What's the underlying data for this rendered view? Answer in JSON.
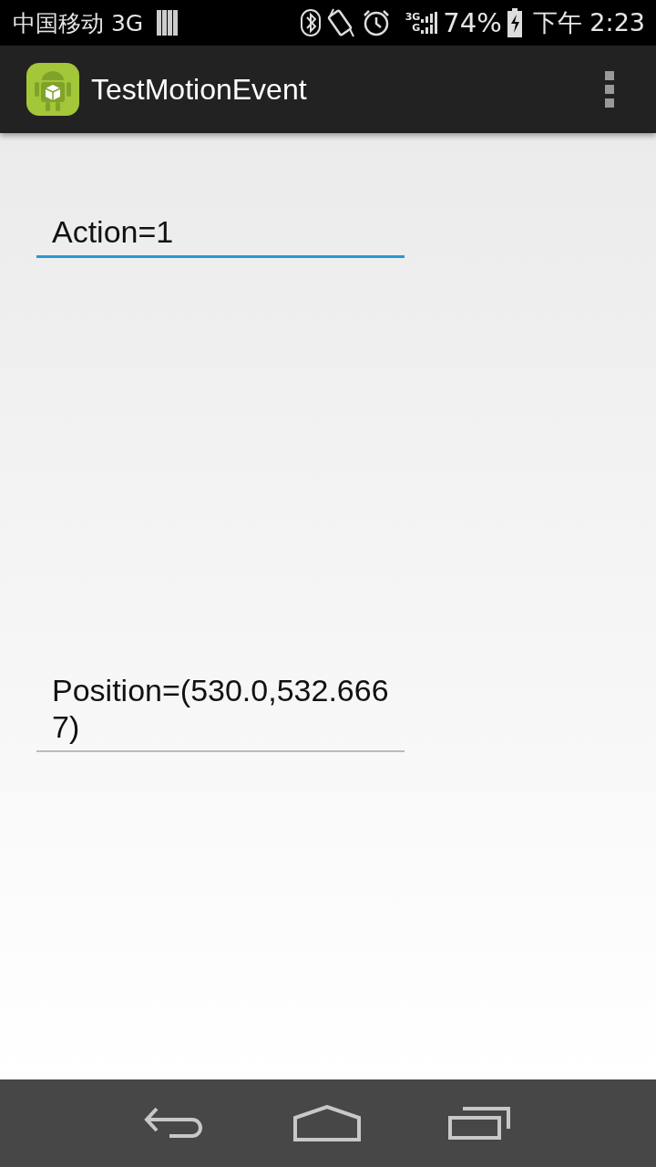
{
  "status_bar": {
    "carrier": "中国移动 3G",
    "network_labels": [
      "3G",
      "G"
    ],
    "battery": "74%",
    "time": "下午 2:23"
  },
  "app_bar": {
    "title": "TestMotionEvent"
  },
  "fields": [
    {
      "value": "Action=1",
      "focused": true
    },
    {
      "value": "Position=(530.0,532.6667)",
      "focused": false
    }
  ]
}
